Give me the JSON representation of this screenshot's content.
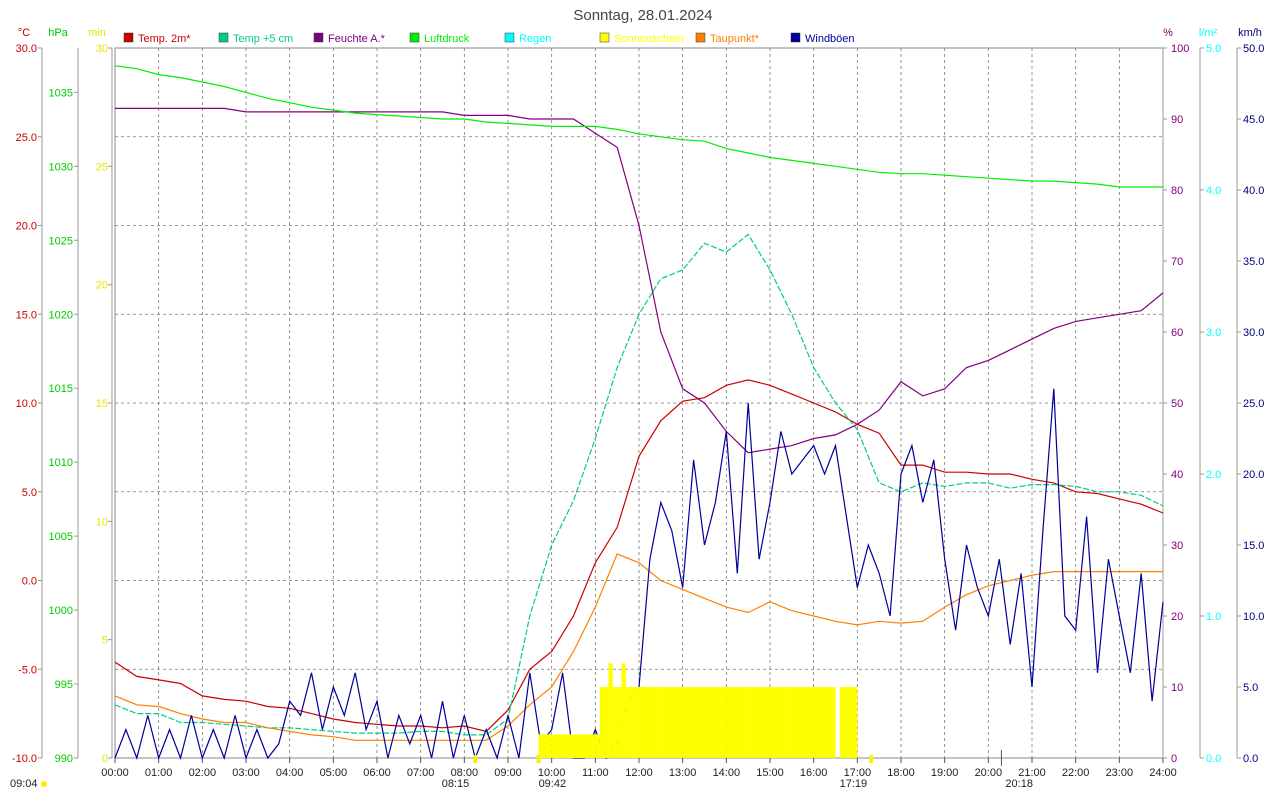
{
  "chart_data": {
    "type": "line",
    "title": "Sonntag, 28.01.2024",
    "x_ticks": [
      "00:00",
      "01:00",
      "02:00",
      "03:00",
      "04:00",
      "05:00",
      "06:00",
      "07:00",
      "08:00",
      "09:00",
      "10:00",
      "11:00",
      "12:00",
      "13:00",
      "14:00",
      "15:00",
      "16:00",
      "17:00",
      "18:00",
      "19:00",
      "20:00",
      "21:00",
      "22:00",
      "23:00",
      "24:00"
    ],
    "xlim": [
      0,
      24
    ],
    "axes": {
      "temp": {
        "unit": "°C",
        "color": "#cc0000",
        "ylim": [
          -10,
          30
        ],
        "ticks": [
          "30.0",
          "25.0",
          "20.0",
          "15.0",
          "10.0",
          "5.0",
          "0.0",
          "-5.0",
          "-10.0"
        ]
      },
      "pressure": {
        "unit": "hPa",
        "color": "#00cc00",
        "ylim": [
          990,
          1038
        ],
        "ticks": [
          "1035",
          "1030",
          "1025",
          "1020",
          "1015",
          "1010",
          "1005",
          "1000",
          "995",
          "990"
        ]
      },
      "minutes": {
        "unit": "min",
        "color": "#e6e600",
        "ylim": [
          0,
          30
        ],
        "ticks": [
          "30",
          "25",
          "20",
          "15",
          "10",
          "5",
          "0"
        ]
      },
      "humidity": {
        "unit": "%",
        "color": "#800080",
        "ylim": [
          0,
          100
        ],
        "ticks": [
          "100",
          "90",
          "80",
          "70",
          "60",
          "50",
          "40",
          "30",
          "20",
          "10",
          "0"
        ]
      },
      "rain": {
        "unit": "l/m²",
        "color": "#00ffff",
        "ylim": [
          0,
          5
        ],
        "ticks": [
          "5.0",
          "4.0",
          "3.0",
          "2.0",
          "1.0",
          "0.0"
        ]
      },
      "wind": {
        "unit": "km/h",
        "color": "#000080",
        "ylim": [
          0,
          50
        ],
        "ticks": [
          "50.0",
          "45.0",
          "40.0",
          "35.0",
          "30.0",
          "25.0",
          "20.0",
          "15.0",
          "10.0",
          "5.0",
          "0.0"
        ]
      }
    },
    "legend": [
      {
        "name": "Temp. 2m*",
        "color": "#cc0000"
      },
      {
        "name": "Temp +5 cm",
        "color": "#00cc88"
      },
      {
        "name": "Feuchte A.*",
        "color": "#800080"
      },
      {
        "name": "Luftdruck",
        "color": "#00ee00"
      },
      {
        "name": "Regen",
        "color": "#00ffff"
      },
      {
        "name": "Sonnenschein",
        "color": "#ffff00"
      },
      {
        "name": "Taupunkt*",
        "color": "#ff8000"
      },
      {
        "name": "Windböen",
        "color": "#000099"
      }
    ],
    "sun_events": {
      "bottom_left": "09:04",
      "sunrise": "08:15",
      "sun_start": "09:42",
      "sunset": "17:19",
      "moon": "20:18"
    },
    "series": [
      {
        "name": "Temp. 2m*",
        "axis": "temp",
        "x": [
          0,
          0.5,
          1,
          1.5,
          2,
          2.5,
          3,
          3.5,
          4,
          4.5,
          5,
          5.5,
          6,
          6.5,
          7,
          7.5,
          8,
          8.5,
          9,
          9.5,
          10,
          10.5,
          11,
          11.5,
          12,
          12.5,
          13,
          13.5,
          14,
          14.5,
          15,
          15.5,
          16,
          16.5,
          17,
          17.5,
          18,
          18.5,
          19,
          19.5,
          20,
          20.5,
          21,
          21.5,
          22,
          22.5,
          23,
          23.5,
          24
        ],
        "y": [
          -4.6,
          -5.4,
          -5.6,
          -5.8,
          -6.5,
          -6.7,
          -6.8,
          -7.1,
          -7.2,
          -7.5,
          -7.8,
          -8.0,
          -8.1,
          -8.2,
          -8.2,
          -8.3,
          -8.2,
          -8.5,
          -7.3,
          -5.0,
          -4.0,
          -2.0,
          1.0,
          3.0,
          7.0,
          9.0,
          10.1,
          10.3,
          11.0,
          11.3,
          11.0,
          10.5,
          10.0,
          9.5,
          8.8,
          8.3,
          6.5,
          6.5,
          6.1,
          6.1,
          6.0,
          6.0,
          5.7,
          5.5,
          5.0,
          4.9,
          4.6,
          4.3,
          3.8
        ]
      },
      {
        "name": "Temp +5 cm",
        "axis": "temp",
        "x": [
          0,
          0.5,
          1,
          1.5,
          2,
          2.5,
          3,
          3.5,
          4,
          4.5,
          5,
          5.5,
          6,
          6.5,
          7,
          7.5,
          8,
          8.5,
          9,
          9.5,
          10,
          10.5,
          11,
          11.5,
          12,
          12.5,
          13,
          13.5,
          14,
          14.5,
          15,
          15.5,
          16,
          16.5,
          17,
          17.5,
          18,
          18.5,
          19,
          19.5,
          20,
          20.5,
          21,
          21.5,
          22,
          22.5,
          23,
          23.5,
          24
        ],
        "y": [
          -7.0,
          -7.5,
          -7.5,
          -8.0,
          -8.0,
          -8.1,
          -8.2,
          -8.3,
          -8.3,
          -8.4,
          -8.5,
          -8.6,
          -8.6,
          -8.6,
          -8.5,
          -8.5,
          -8.7,
          -8.7,
          -7.8,
          -2.0,
          2.0,
          4.5,
          8.0,
          12.0,
          15.0,
          17.0,
          17.5,
          19.0,
          18.5,
          19.5,
          17.5,
          15.0,
          12.0,
          10.0,
          8.5,
          5.5,
          5.0,
          5.5,
          5.3,
          5.5,
          5.5,
          5.2,
          5.4,
          5.4,
          5.3,
          5.0,
          5.0,
          4.8,
          4.2
        ]
      },
      {
        "name": "Feuchte A.*",
        "axis": "humidity",
        "x": [
          0,
          0.5,
          1,
          1.5,
          2,
          2.5,
          3,
          3.5,
          4,
          4.5,
          5,
          5.5,
          6,
          6.5,
          7,
          7.5,
          8,
          8.5,
          9,
          9.5,
          10,
          10.5,
          11,
          11.5,
          12,
          12.5,
          13,
          13.5,
          14,
          14.5,
          15,
          15.5,
          16,
          16.5,
          17,
          17.5,
          18,
          18.5,
          19,
          19.5,
          20,
          20.5,
          21,
          21.5,
          22,
          22.5,
          23,
          23.5,
          24
        ],
        "y": [
          91.5,
          91.5,
          91.5,
          91.5,
          91.5,
          91.5,
          91.0,
          91.0,
          91.0,
          91.0,
          91.0,
          91.0,
          91.0,
          91.0,
          91.0,
          91.0,
          90.5,
          90.5,
          90.5,
          90.0,
          90.0,
          90.0,
          88.0,
          86.0,
          75.0,
          60.0,
          52.0,
          50.0,
          46.0,
          43.0,
          43.5,
          44.0,
          45.0,
          45.5,
          47.0,
          49.0,
          53.0,
          51.0,
          52.0,
          55.0,
          56.0,
          57.5,
          59.0,
          60.5,
          61.5,
          62.0,
          62.5,
          63.0,
          65.5
        ]
      },
      {
        "name": "Luftdruck",
        "axis": "pressure",
        "x": [
          0,
          0.5,
          1,
          1.5,
          2,
          2.5,
          3,
          3.5,
          4,
          4.5,
          5,
          5.5,
          6,
          6.5,
          7,
          7.5,
          8,
          8.5,
          9,
          9.5,
          10,
          10.5,
          11,
          11.5,
          12,
          12.5,
          13,
          13.5,
          14,
          14.5,
          15,
          15.5,
          16,
          16.5,
          17,
          17.5,
          18,
          18.5,
          19,
          19.5,
          20,
          20.5,
          21,
          21.5,
          22,
          22.5,
          23,
          23.5,
          24
        ],
        "y": [
          1036.8,
          1036.6,
          1036.2,
          1036.0,
          1035.7,
          1035.4,
          1035.0,
          1034.6,
          1034.3,
          1034.0,
          1033.8,
          1033.6,
          1033.5,
          1033.4,
          1033.3,
          1033.2,
          1033.2,
          1033.0,
          1032.9,
          1032.8,
          1032.7,
          1032.7,
          1032.7,
          1032.5,
          1032.2,
          1032.0,
          1031.8,
          1031.7,
          1031.2,
          1030.9,
          1030.6,
          1030.4,
          1030.2,
          1030.0,
          1029.8,
          1029.6,
          1029.5,
          1029.5,
          1029.4,
          1029.3,
          1029.2,
          1029.1,
          1029.0,
          1029.0,
          1028.9,
          1028.8,
          1028.6,
          1028.6,
          1028.6
        ]
      },
      {
        "name": "Taupunkt*",
        "axis": "temp",
        "x": [
          0,
          0.5,
          1,
          1.5,
          2,
          2.5,
          3,
          3.5,
          4,
          4.5,
          5,
          5.5,
          6,
          6.5,
          7,
          7.5,
          8,
          8.5,
          9,
          9.5,
          10,
          10.5,
          11,
          11.5,
          12,
          12.5,
          13,
          13.5,
          14,
          14.5,
          15,
          15.5,
          16,
          16.5,
          17,
          17.5,
          18,
          18.5,
          19,
          19.5,
          20,
          20.5,
          21,
          21.5,
          22,
          22.5,
          23,
          23.5,
          24
        ],
        "y": [
          -6.5,
          -7.0,
          -7.1,
          -7.5,
          -7.8,
          -8.0,
          -8.0,
          -8.3,
          -8.5,
          -8.7,
          -8.8,
          -9.0,
          -9.0,
          -9.0,
          -9.0,
          -9.0,
          -9.0,
          -9.0,
          -8.2,
          -7.0,
          -6.0,
          -4.0,
          -1.5,
          1.5,
          1.0,
          0.0,
          -0.5,
          -1.0,
          -1.5,
          -1.8,
          -1.2,
          -1.7,
          -2.0,
          -2.3,
          -2.5,
          -2.3,
          -2.4,
          -2.3,
          -1.5,
          -0.8,
          -0.3,
          0.0,
          0.3,
          0.5,
          0.5,
          0.5,
          0.5,
          0.5,
          0.5
        ]
      },
      {
        "name": "Windböen",
        "axis": "wind",
        "x": [
          0,
          0.25,
          0.5,
          0.75,
          1,
          1.25,
          1.5,
          1.75,
          2,
          2.25,
          2.5,
          2.75,
          3,
          3.25,
          3.5,
          3.75,
          4,
          4.25,
          4.5,
          4.75,
          5,
          5.25,
          5.5,
          5.75,
          6,
          6.25,
          6.5,
          6.75,
          7,
          7.25,
          7.5,
          7.75,
          8,
          8.25,
          8.5,
          8.75,
          9,
          9.25,
          9.5,
          9.75,
          10,
          10.25,
          10.5,
          10.75,
          11,
          11.25,
          11.5,
          11.75,
          12,
          12.25,
          12.5,
          12.75,
          13,
          13.25,
          13.5,
          13.75,
          14,
          14.25,
          14.5,
          14.75,
          15,
          15.25,
          15.5,
          15.75,
          16,
          16.25,
          16.5,
          16.75,
          17,
          17.25,
          17.5,
          17.75,
          18,
          18.25,
          18.5,
          18.75,
          19,
          19.25,
          19.5,
          19.75,
          20,
          20.25,
          20.5,
          20.75,
          21,
          21.25,
          21.5,
          21.75,
          22,
          22.25,
          22.5,
          22.75,
          23,
          23.25,
          23.5,
          23.75,
          24
        ],
        "y": [
          0,
          2,
          0,
          3,
          0,
          2,
          0,
          3,
          0,
          2,
          0,
          3,
          0,
          2,
          0,
          1,
          4,
          3,
          6,
          2,
          5,
          3,
          6,
          2,
          4,
          0,
          3,
          1,
          3,
          0,
          4,
          0,
          3,
          0,
          2,
          0,
          3,
          0,
          6,
          1,
          2,
          6,
          0,
          0,
          2,
          0,
          1,
          4,
          5,
          14,
          18,
          16,
          12,
          21,
          15,
          18,
          23,
          13,
          25,
          14,
          18,
          23,
          20,
          21,
          22,
          20,
          22,
          17,
          12,
          15,
          13,
          10,
          20,
          22,
          18,
          21,
          14,
          9,
          15,
          12,
          10,
          14,
          8,
          13,
          5,
          16,
          26,
          10,
          9,
          17,
          6,
          14,
          10,
          6,
          13,
          4,
          11
        ]
      },
      {
        "name": "Sonnenschein",
        "axis": "minutes",
        "x": [
          0,
          9.6,
          9.7,
          9.8,
          10,
          10.5,
          11,
          11.1,
          11.2,
          11.3,
          11.4,
          11.5,
          11.6,
          11.7,
          11.8,
          11.9,
          12,
          12.5,
          13,
          13.5,
          14,
          14.5,
          15,
          15.5,
          16,
          16.2,
          16.5,
          16.6,
          17,
          24
        ],
        "y": [
          0,
          0,
          1,
          1,
          1,
          1,
          1,
          3,
          3,
          4,
          3,
          3,
          4,
          3,
          3,
          3,
          3,
          3,
          3,
          3,
          3,
          3,
          3,
          3,
          3,
          3,
          0,
          3,
          0,
          0
        ]
      }
    ]
  }
}
